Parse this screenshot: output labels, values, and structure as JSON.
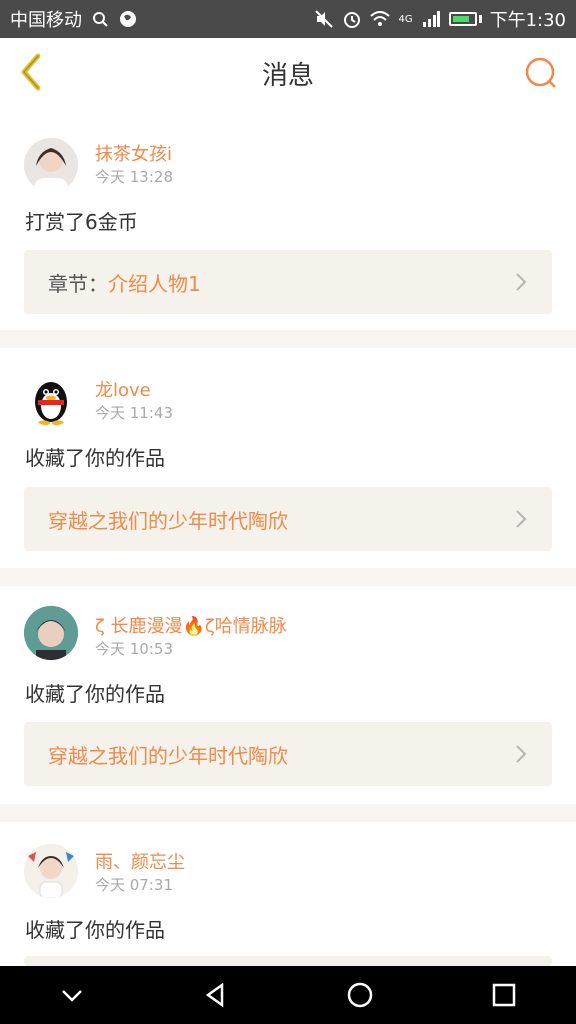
{
  "status_bar": {
    "carrier": "中国移动",
    "network": "4G",
    "time": "下午1:30"
  },
  "header": {
    "title": "消息",
    "back_icon": "chevron-left-icon",
    "search_icon": "search-icon"
  },
  "messages": [
    {
      "username": "抹茶女孩i",
      "time": "今天 13:28",
      "action": "打赏了6金币",
      "link_prefix": "章节：",
      "link_text": "介绍人物1"
    },
    {
      "username": "龙love",
      "time": "今天 11:43",
      "action": "收藏了你的作品",
      "link_prefix": "",
      "link_text": "穿越之我们的少年时代陶欣"
    },
    {
      "username": "ζ   长鹿漫漫🔥ζ哈情脉脉",
      "time": "今天 10:53",
      "action": "收藏了你的作品",
      "link_prefix": "",
      "link_text": "穿越之我们的少年时代陶欣"
    },
    {
      "username": "雨、颜忘尘",
      "time": "今天 07:31",
      "action": "收藏了你的作品",
      "link_prefix": "",
      "link_text": ""
    }
  ],
  "colors": {
    "accent": "#f08a4b",
    "status_bar": "#4a4a4a",
    "link_bg": "#f4f2ea",
    "divider": "#f7f4f1"
  },
  "system_nav": {
    "icons": [
      "chevron-down-icon",
      "back-triangle-icon",
      "home-circle-icon",
      "recents-square-icon"
    ]
  }
}
